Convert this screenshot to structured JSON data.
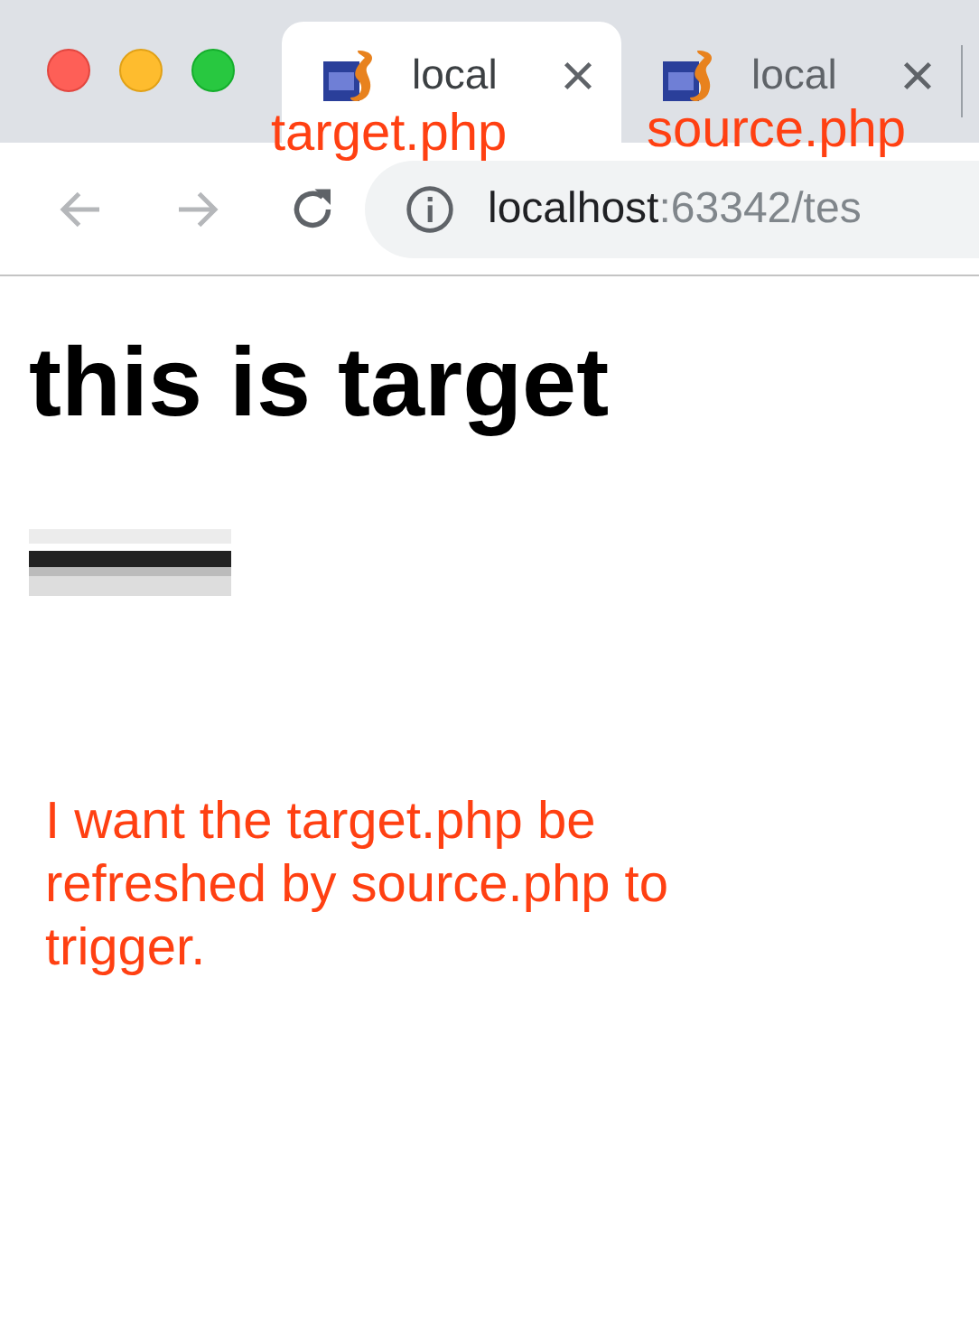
{
  "tabs": [
    {
      "title": "local",
      "annotation": "target.php",
      "selected": true
    },
    {
      "title": "local",
      "annotation": "source.php",
      "selected": false
    }
  ],
  "address_bar": {
    "host": "localhost",
    "path": ":63342/tes"
  },
  "page": {
    "heading": "this is target",
    "note": "I want the target.php be refreshed by source.php to trigger."
  }
}
